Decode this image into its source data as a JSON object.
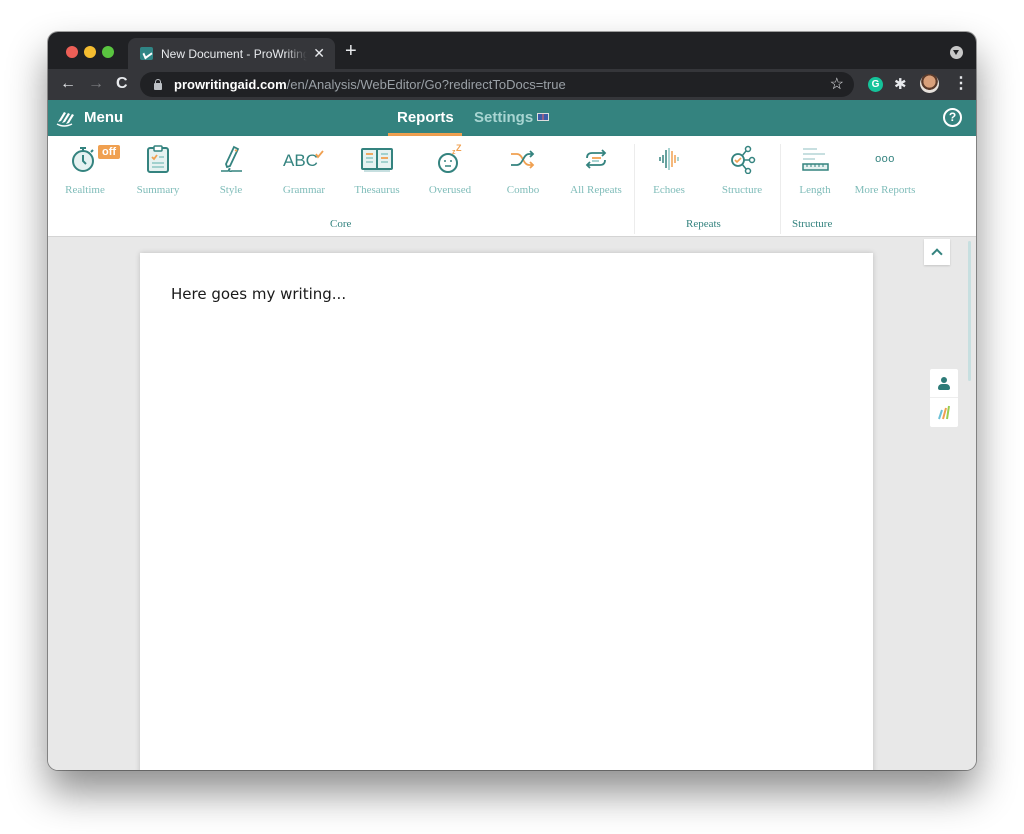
{
  "browser": {
    "tab": {
      "title": "New Document - ProWritingAid",
      "close_icon": "close-icon"
    },
    "new_tab_label": "+",
    "url": {
      "host": "prowritingaid.com",
      "path": "/en/Analysis/WebEditor/Go?redirectToDocs=true"
    },
    "nav": {
      "back": "←",
      "forward": "→",
      "reload": "C"
    },
    "star": "☆",
    "grammarly_label": "G",
    "puzzle": "✱",
    "kebab": "⋮"
  },
  "app": {
    "menu_label": "Menu",
    "nav_tabs": [
      {
        "label": "Reports",
        "active": true
      },
      {
        "label": "Settings",
        "active": false
      }
    ],
    "help_label": "?"
  },
  "reports": {
    "realtime_badge": "off",
    "items": [
      {
        "label": "Realtime",
        "icon": "stopwatch-icon"
      },
      {
        "label": "Summary",
        "icon": "clipboard-icon"
      },
      {
        "label": "Style",
        "icon": "pen-icon"
      },
      {
        "label": "Grammar",
        "icon": "abc-check-icon"
      },
      {
        "label": "Thesaurus",
        "icon": "book-icon"
      },
      {
        "label": "Overused",
        "icon": "sleepy-face-icon"
      },
      {
        "label": "Combo",
        "icon": "shuffle-icon"
      },
      {
        "label": "All Repeats",
        "icon": "repeat-icon"
      },
      {
        "label": "Echoes",
        "icon": "soundwave-icon"
      },
      {
        "label": "Structure",
        "icon": "structure-nodes-icon"
      },
      {
        "label": "Length",
        "icon": "ruler-icon"
      },
      {
        "label": "More Reports",
        "icon": "more-icon"
      }
    ],
    "groups": [
      {
        "label": "Core"
      },
      {
        "label": "Repeats"
      },
      {
        "label": "Structure"
      }
    ],
    "more_glyph": "ooo"
  },
  "document": {
    "text": "Here goes my writing..."
  },
  "colors": {
    "brand_teal": "#34837f",
    "accent_orange": "#f0a050",
    "label_teal_light": "#7fbcb9"
  }
}
